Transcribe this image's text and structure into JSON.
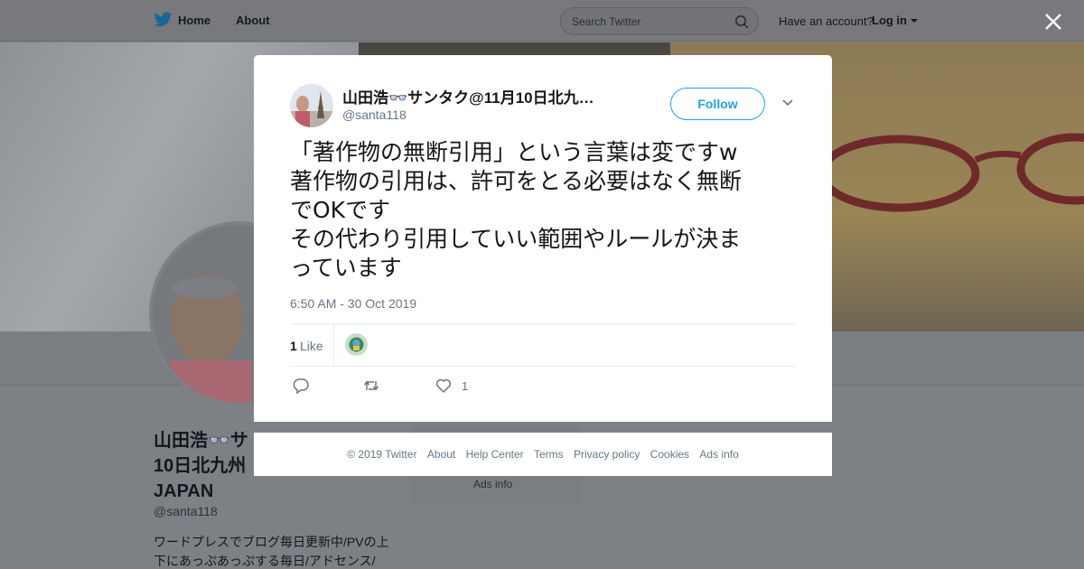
{
  "nav": {
    "home": "Home",
    "about": "About",
    "search_placeholder": "Search Twitter",
    "account_question": "Have an account?",
    "login": "Log in"
  },
  "background": {
    "name": "山田浩👓サンタク@11月10日北九州JAPAN",
    "name_visible_line1": "山田浩👓サ",
    "name_visible_line2": "10日北九州",
    "name_visible_line3": "JAPAN",
    "handle": "@santa118",
    "bio_line1": "ワードプレスでブログ毎日更新中/PVの上",
    "bio_line2": "下にあっぷあっぷする毎日/アドセンス/",
    "ads_info": "Ads info"
  },
  "tweet": {
    "author_name": "山田浩👓サンタク@11月10日北九…",
    "author_handle": "@santa118",
    "follow_label": "Follow",
    "text_lines": [
      "「著作物の無断引用」という言葉は変ですw",
      "著作物の引用は、許可をとる必要はなく無断",
      "でOKです",
      "その代わり引用していい範囲やルールが決ま",
      "っています"
    ],
    "timestamp": "6:50 AM - 30 Oct 2019",
    "likes_count": "1",
    "likes_label": "Like",
    "action_like_count": "1"
  },
  "footer": {
    "links": [
      "© 2019 Twitter",
      "About",
      "Help Center",
      "Terms",
      "Privacy policy",
      "Cookies",
      "Ads info"
    ]
  },
  "colors": {
    "accent": "#1da1f2",
    "secondary_text": "#657786",
    "overlay": "#7d8287"
  },
  "icons": [
    "twitter-bird-icon",
    "search-icon",
    "caret-down-icon",
    "close-icon",
    "chevron-down-icon",
    "reply-icon",
    "retweet-icon",
    "heart-icon"
  ]
}
